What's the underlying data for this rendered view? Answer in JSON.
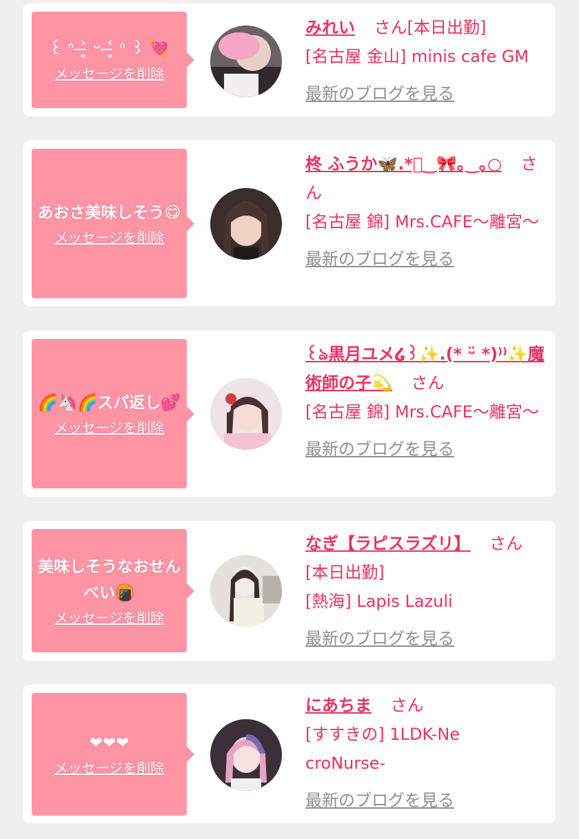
{
  "colors": {
    "background": "#efefef",
    "card": "#ffffff",
    "bubble": "#ff94a5",
    "accent": "#e8335f",
    "link_gray": "#8f8f8f"
  },
  "labels": {
    "delete_message": "メッセージを削除",
    "san": "さん",
    "latest_blog": "最新のブログを見る"
  },
  "entries": [
    {
      "message": "꒰ ᐢ ˃̶͈ ᵕ ˂̶͈ ᐢ ꒱ 💘",
      "name": "みれい",
      "status": "[本日出勤]",
      "shop": "[名古屋 金山] minis cafe GM",
      "avatar_icon": "avatar-photo"
    },
    {
      "message": "あおさ美味しそう😋",
      "name": "柊 ふうか🦋.*゚‿🎀｡‿｡○",
      "status": "",
      "shop": "[名古屋 錦] Mrs.CAFE〜離宮〜",
      "avatar_icon": "avatar-photo"
    },
    {
      "message": "🌈🦄🌈スパ返し💕",
      "name": "꒰ঌ黒月ユメ໒꒱✨.(* ᵕ̈ *)⁾⁾✨魔術師の子💫",
      "status": "",
      "shop": "[名古屋 錦] Mrs.CAFE〜離宮〜",
      "avatar_icon": "avatar-photo"
    },
    {
      "message": "美味しそうなおせんべい🍘",
      "name": "なぎ【ラピスラズリ】",
      "status": "[本日出勤]",
      "shop": "[熱海] Lapis Lazuli",
      "avatar_icon": "avatar-photo"
    },
    {
      "message": "❤❤❤",
      "name": "にあちま",
      "status": "",
      "shop": "[すすきの] 1LDK-NecroNurse-",
      "avatar_icon": "avatar-photo"
    }
  ]
}
